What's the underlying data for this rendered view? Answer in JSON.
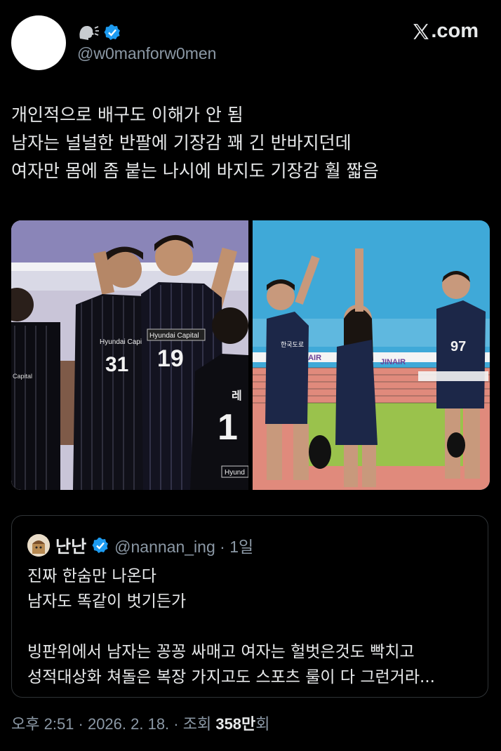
{
  "header": {
    "display_name_icon": "speaking-head-icon",
    "verified_icon": "verified-badge-icon",
    "handle": "@w0manforw0men",
    "source_label": ".com",
    "source_icon": "x-logo-icon"
  },
  "tweet": {
    "text": "개인적으로 배구도 이해가 안 됨\n남자는 널널한 반팔에 기장감 꽤 긴 반바지던데\n여자만 몸에 좀 붙는 나시에 바지도 기장감 훨 짧음"
  },
  "media": {
    "left_jersey_numbers": [
      "31",
      "19",
      "1"
    ],
    "left_jersey_text": [
      "Hyundai Capit",
      "Hyundai Capital",
      "Capital",
      "레",
      "Hyund"
    ],
    "right_jersey_numbers": [
      "97"
    ],
    "right_banner_text": "JINAIR"
  },
  "quote": {
    "name": "난난",
    "handle": "@nannan_ing · 1일",
    "text": "진짜 한숨만 나온다\n남자도 똑같이 벗기든가\n\n빙판위에서 남자는 꽁꽁 싸매고 여자는 헐벗은것도 빡치고\n성적대상화 쳐돌은 복장 가지고도 스포츠 룰이 다 그런거라..."
  },
  "footer": {
    "time": "오후 2:51 · 2026. 2. 18. · 조회 ",
    "views": "358만",
    "views_suffix": "회"
  }
}
